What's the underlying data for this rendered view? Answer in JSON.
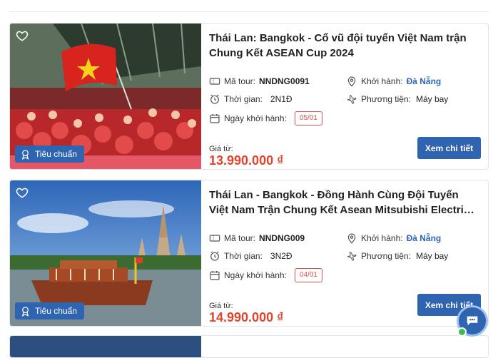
{
  "tours": [
    {
      "title": "Thái Lan: Bangkok - Cổ vũ đội tuyển Việt Nam trận Chung Kết ASEAN Cup 2024",
      "badge": "Tiêu chuẩn",
      "code_label": "Mã tour:",
      "code": "NNDNG0091",
      "depart_label": "Khởi hành:",
      "depart": "Đà Nẵng",
      "duration_label": "Thời gian:",
      "duration": "2N1Đ",
      "transport_label": "Phương tiện:",
      "transport": "Máy bay",
      "date_label": "Ngày khởi hành:",
      "date": "05/01",
      "price_label": "Giá từ:",
      "price": "13.990.000 ₫",
      "button": "Xem chi tiết"
    },
    {
      "title": "Thái Lan - Bangkok - Đồng Hành Cùng Đội Tuyển Việt Nam Trận Chung Kết Asean Mitsubishi Electri…",
      "badge": "Tiêu chuẩn",
      "code_label": "Mã tour:",
      "code": "NNDNG009",
      "depart_label": "Khởi hành:",
      "depart": "Đà Nẵng",
      "duration_label": "Thời gian:",
      "duration": "3N2Đ",
      "transport_label": "Phương tiện:",
      "transport": "Máy bay",
      "date_label": "Ngày khởi hành:",
      "date": "04/01",
      "price_label": "Giá từ:",
      "price": "14.990.000 ₫",
      "button": "Xem chi tiết"
    }
  ],
  "icons": {
    "favorite": "heart-icon",
    "badge": "award-icon",
    "code": "ticket-icon",
    "depart": "location-pin-icon",
    "duration": "clock-icon",
    "transport": "plane-icon",
    "date": "calendar-icon",
    "chat": "chat-bubble-icon"
  },
  "colors": {
    "primary": "#2f64b0",
    "price": "#e0442c",
    "date_pill": "#d9534f",
    "online": "#3cba54"
  }
}
